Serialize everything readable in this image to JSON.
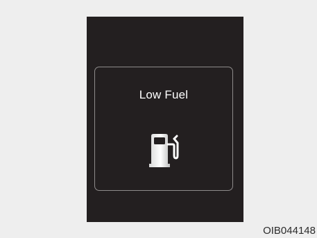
{
  "display": {
    "message": "Low Fuel",
    "icon": "fuel-pump-icon"
  },
  "figure": {
    "code": "OIB044148"
  },
  "colors": {
    "page_background": "#eeeeee",
    "panel_background": "#231f20",
    "frame_border": "#8f8c8c",
    "text": "#ffffff"
  }
}
